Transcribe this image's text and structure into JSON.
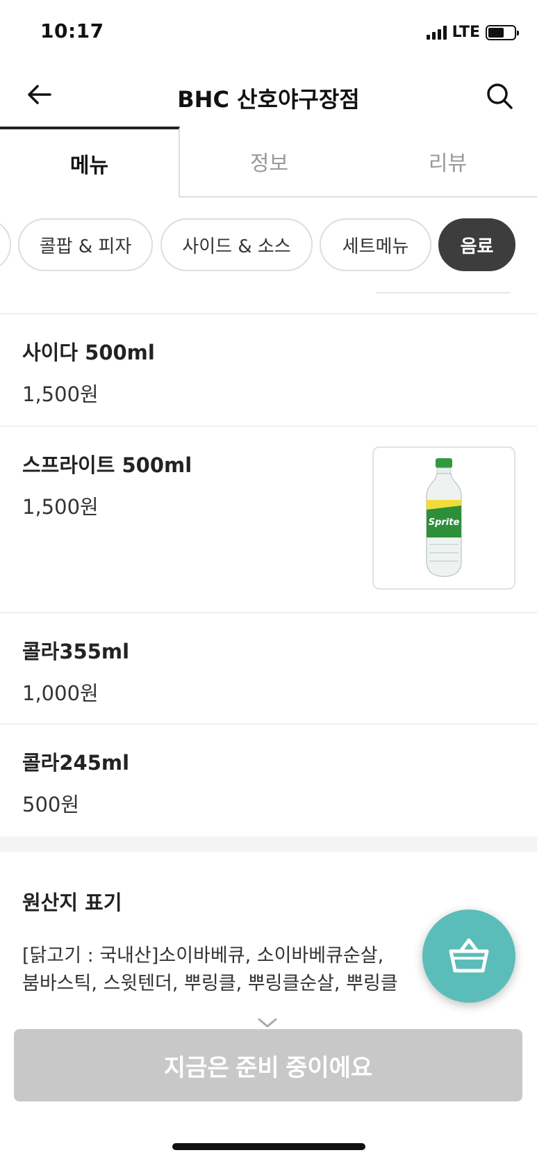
{
  "status": {
    "time": "10:17",
    "network": "LTE"
  },
  "header": {
    "title": "BHC 산호야구장점",
    "back_icon": "arrow-left-icon",
    "search_icon": "search-icon"
  },
  "tabs": [
    {
      "label": "메뉴",
      "active": true
    },
    {
      "label": "정보",
      "active": false
    },
    {
      "label": "리뷰",
      "active": false
    }
  ],
  "categories": [
    {
      "label": "콜팝 & 피자",
      "active": false
    },
    {
      "label": "사이드 & 소스",
      "active": false
    },
    {
      "label": "세트메뉴",
      "active": false
    },
    {
      "label": "음료",
      "active": true
    }
  ],
  "menu_items": [
    {
      "name": "사이다 500ml",
      "price": "1,500원",
      "has_image": false
    },
    {
      "name": "스프라이트 500ml",
      "price": "1,500원",
      "has_image": true,
      "image_icon": "sprite-bottle-icon",
      "image_label": "Sprite"
    },
    {
      "name": "콜라355ml",
      "price": "1,000원",
      "has_image": false
    },
    {
      "name": "콜라245ml",
      "price": "500원",
      "has_image": false
    }
  ],
  "origin": {
    "title": "원산지 표기",
    "line1": "[닭고기 : 국내산]소이바베큐, 소이바베큐순살,",
    "line2": "붐바스틱, 스윗텐더, 뿌링클, 뿌링클순살, 뿌링클"
  },
  "cart": {
    "icon": "basket-icon",
    "color": "#5bbdb9"
  },
  "order_button": {
    "label": "지금은 준비 중이에요",
    "color": "#c8c8c8"
  },
  "colors": {
    "active_chip": "#3d3d3d",
    "accent": "#5bbdb9"
  }
}
